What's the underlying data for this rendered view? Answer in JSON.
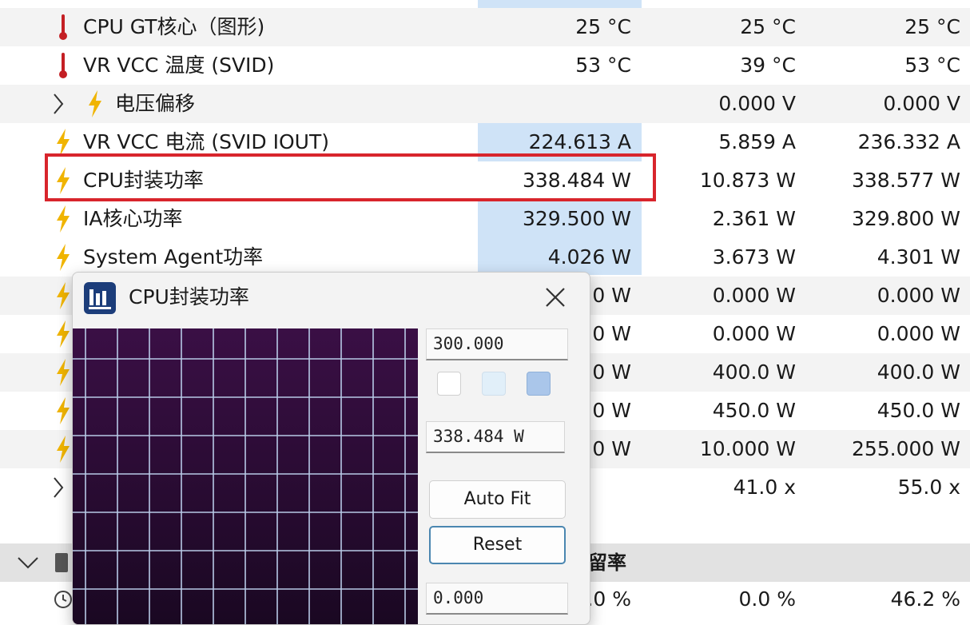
{
  "rows": [
    {
      "name": "CPU GT核心（图形)",
      "v1": "25 °C",
      "v2": "25 °C",
      "v3": "25 °C",
      "icon": "thermometer-icon"
    },
    {
      "name": "VR VCC 温度 (SVID)",
      "v1": "53 °C",
      "v2": "39 °C",
      "v3": "53 °C",
      "icon": "thermometer-icon"
    },
    {
      "name": "电压偏移",
      "v1": "",
      "v2": "0.000 V",
      "v3": "0.000 V",
      "icon": "lightning-icon",
      "expand": true
    },
    {
      "name": "VR VCC 电流 (SVID IOUT)",
      "v1": "224.613 A",
      "v2": "5.859 A",
      "v3": "236.332 A",
      "icon": "lightning-icon"
    },
    {
      "name": "CPU封装功率",
      "v1": "338.484 W",
      "v2": "10.873 W",
      "v3": "338.577 W",
      "icon": "lightning-icon"
    },
    {
      "name": "IA核心功率",
      "v1": "329.500 W",
      "v2": "2.361 W",
      "v3": "329.800 W",
      "icon": "lightning-icon"
    },
    {
      "name": "System Agent功率",
      "v1": "4.026 W",
      "v2": "3.673 W",
      "v3": "4.301 W",
      "icon": "lightning-icon"
    },
    {
      "name": "",
      "v1": "0 W",
      "v2": "0.000 W",
      "v3": "0.000 W",
      "icon": "lightning-icon"
    },
    {
      "name": "",
      "v1": "0 W",
      "v2": "0.000 W",
      "v3": "0.000 W",
      "icon": "lightning-icon"
    },
    {
      "name": "",
      "v1": "0 W",
      "v2": "400.0 W",
      "v3": "400.0 W",
      "icon": "lightning-icon"
    },
    {
      "name": "",
      "v1": "0 W",
      "v2": "450.0 W",
      "v3": "450.0 W",
      "icon": "lightning-icon"
    },
    {
      "name": "",
      "v1": "0 W",
      "v2": "10.000 W",
      "v3": "255.000 W",
      "icon": "lightning-icon"
    },
    {
      "name": "",
      "v1": "",
      "v2": "41.0 x",
      "v3": "55.0 x",
      "icon": "chevron-right-icon",
      "expand": true
    }
  ],
  "section": {
    "label": "留率"
  },
  "bottom_row": {
    "v1": ".0 %",
    "v2": "0.0 %",
    "v3": "46.2 %"
  },
  "popup": {
    "title": "CPU封装功率",
    "max_value": "300.000",
    "current_value": "338.484 W",
    "min_value": "0.000",
    "auto_fit_label": "Auto Fit",
    "reset_label": "Reset",
    "swatches": [
      "#ffffff",
      "#e1eff9",
      "#aac6ea"
    ]
  },
  "colors": {
    "highlight": "#cfe3f7",
    "red_box": "#d8252c",
    "bolt": "#f0b400",
    "thermo": "#c41f24",
    "graph_bg": "#240b2d",
    "grid": "#b7c9e6"
  }
}
